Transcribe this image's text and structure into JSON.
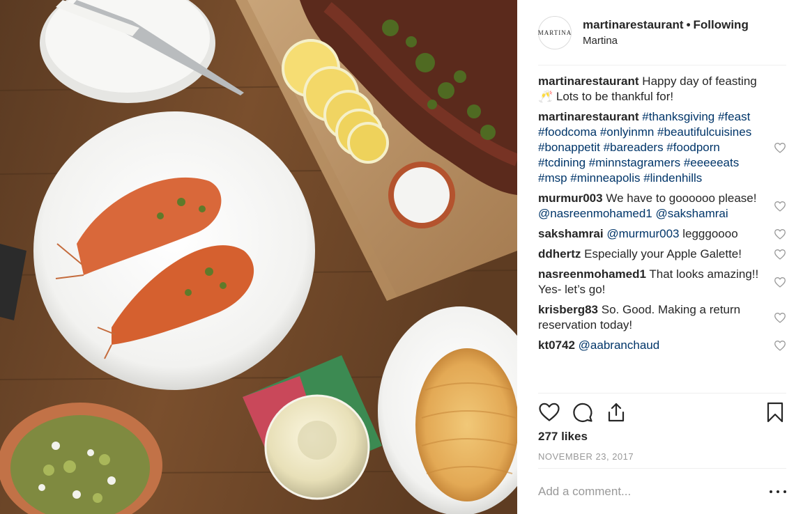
{
  "post": {
    "username": "martinarestaurant",
    "separator": "•",
    "follow_status": "Following",
    "location": "Martina",
    "avatar_text": "MARTINA"
  },
  "comments": [
    {
      "user": "martinarestaurant",
      "text": "Happy day of feasting 🥂 Lots to be thankful for!",
      "tags": "",
      "has_like": false
    },
    {
      "user": "martinarestaurant",
      "text": "",
      "tags": "#thanksgiving #feast #foodcoma #onlyinmn #beautifulcuisines #bonappetit #bareaders #foodporn #tcdining #minnstagramers #eeeeeats #msp #minneapolis #lindenhills",
      "has_like": true
    },
    {
      "user": "murmur003",
      "text": "We have to goooooo please!",
      "tags": "@nasreenmohamed1 @sakshamrai",
      "has_like": true
    },
    {
      "user": "sakshamrai",
      "text": "",
      "tags": "@murmur003",
      "text_after": "legggoooo",
      "has_like": true
    },
    {
      "user": "ddhertz",
      "text": "Especially your Apple Galette!",
      "tags": "",
      "has_like": true
    },
    {
      "user": "nasreenmohamed1",
      "text": "That looks amazing!! Yes- let’s go!",
      "tags": "",
      "has_like": true
    },
    {
      "user": "krisberg83",
      "text": "So. Good. Making a return reservation today!",
      "tags": "",
      "has_like": true
    },
    {
      "user": "kt0742",
      "text": "",
      "tags": "@aabranchaud",
      "has_like": true
    }
  ],
  "likes": "277 likes",
  "date": "NOVEMBER 23, 2017",
  "comment_input": {
    "placeholder": "Add a comment..."
  },
  "icons": {
    "like": "heart-outline-icon",
    "comment": "speech-bubble-icon",
    "share": "share-upload-icon",
    "save": "bookmark-icon",
    "more": "more-options-icon"
  },
  "colors": {
    "link": "#003569",
    "muted": "#999999",
    "text": "#262626",
    "divider": "#efefef"
  }
}
